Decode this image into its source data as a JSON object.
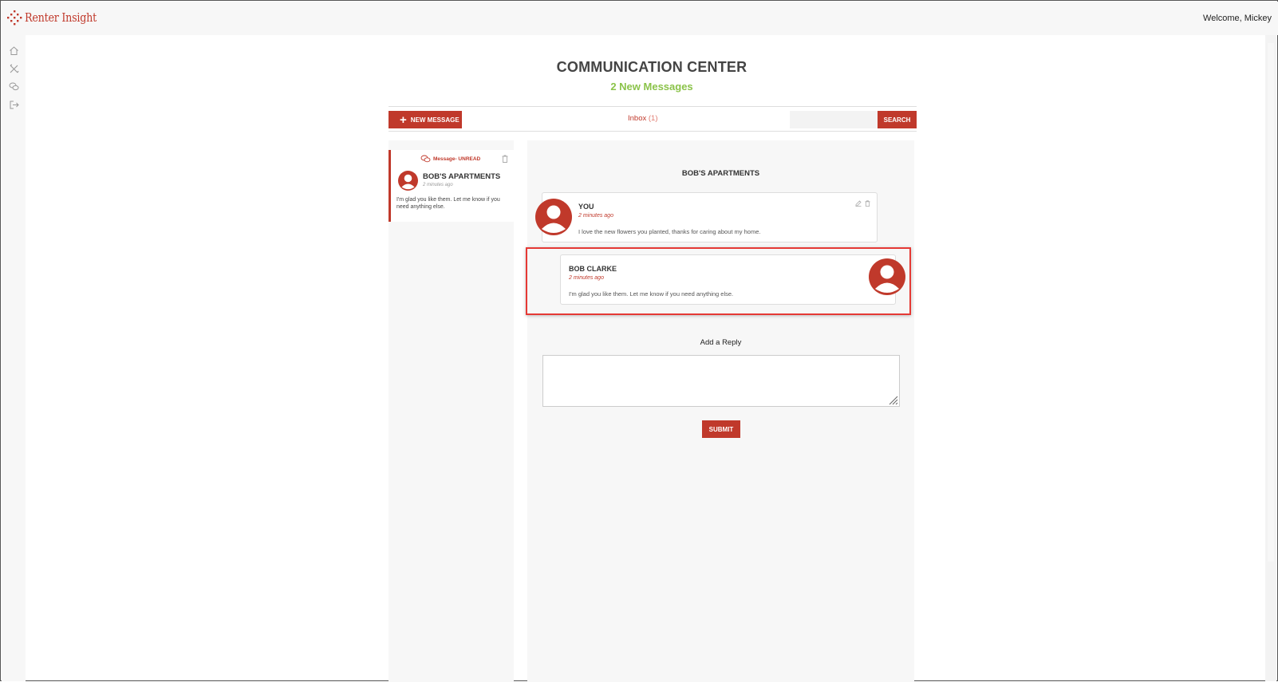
{
  "app": {
    "name": "Renter Insight",
    "welcome": "Welcome, Mickey"
  },
  "sidebar": {
    "icons": [
      "home-icon",
      "tools-icon",
      "chat-icon",
      "logout-icon"
    ]
  },
  "header": {
    "title": "COMMUNICATION CENTER",
    "subtitle": "2 New Messages"
  },
  "toolbar": {
    "new_message": "NEW MESSAGE",
    "inbox_label": "Inbox",
    "inbox_count": "(1)",
    "search_placeholder": "",
    "search_button": "SEARCH"
  },
  "message_list": [
    {
      "status": "Message- UNREAD",
      "name": "BOB'S APARTMENTS",
      "time": "2 minutes ago",
      "preview": "I'm glad you like them. Let me know if you need anything else."
    }
  ],
  "conversation": {
    "title": "BOB'S APARTMENTS",
    "messages": [
      {
        "author": "YOU",
        "time": "2 minutes ago",
        "text": "I love the new flowers you planted, thanks for caring about my home."
      },
      {
        "author": "BOB CLARKE",
        "time": "2 minutes ago",
        "text": "I'm glad you like them.  Let me know if you need anything else."
      }
    ],
    "reply_label": "Add a Reply",
    "reply_value": "",
    "submit": "SUBMIT"
  },
  "colors": {
    "accent": "#c0392b",
    "new_messages": "#8bc34a",
    "highlight": "#e53935"
  }
}
